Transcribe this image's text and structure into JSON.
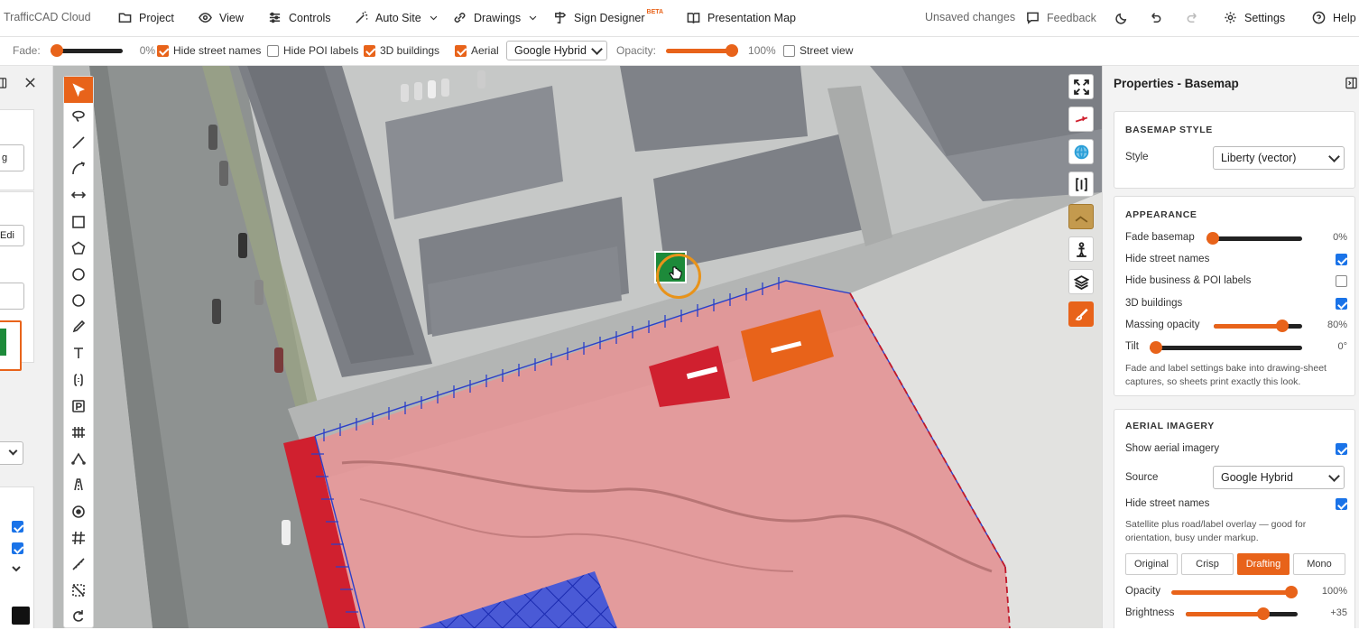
{
  "topbar": {
    "app_title": "TrafficCAD Cloud",
    "menus": [
      "Project",
      "View",
      "Controls",
      "Auto Site",
      "Drawings",
      "Sign Designer",
      "Presentation Map"
    ],
    "beta_label": "BETA",
    "status": "Unsaved changes",
    "feedback": "Feedback",
    "settings": "Settings",
    "help": "Help"
  },
  "layerbar": {
    "fade_label": "Fade:",
    "fade_value": "0%",
    "fade_level": 0,
    "hide_street_names": "Hide street names",
    "hide_poi_labels": "Hide POI labels",
    "buildings_3d": "3D buildings",
    "aerial": "Aerial",
    "source_value": "Google Hybrid",
    "opacity_label": "Opacity:",
    "opacity_value": "100%",
    "opacity_level": 100,
    "street_view": "Street view"
  },
  "leftpanel": {
    "input_tail": "g",
    "select_tail": "Edi"
  },
  "properties": {
    "title": "Properties - Basemap",
    "basemap_style": {
      "heading": "BASEMAP STYLE",
      "style_label": "Style",
      "style_value": "Liberty (vector)"
    },
    "appearance": {
      "heading": "APPEARANCE",
      "fade_label": "Fade basemap",
      "fade_value": "0%",
      "fade_level": 0,
      "hide_street_names": "Hide street names",
      "hide_business": "Hide business & POI labels",
      "buildings_3d": "3D buildings",
      "massing_label": "Massing opacity",
      "massing_value": "80%",
      "massing_level": 80,
      "tilt_label": "Tilt",
      "tilt_value": "0°",
      "tilt_level": 0,
      "note": "Fade and label settings bake into drawing-sheet captures, so sheets print exactly this look."
    },
    "aerial": {
      "heading": "AERIAL IMAGERY",
      "show_label": "Show aerial imagery",
      "source_label": "Source",
      "source_value": "Google Hybrid",
      "hide_street_names": "Hide street names",
      "note": "Satellite plus road/label overlay — good for orientation, busy under markup.",
      "presets": [
        "Original",
        "Crisp",
        "Drafting",
        "Mono"
      ],
      "active_preset": "Drafting",
      "opacity_label": "Opacity",
      "opacity_value": "100%",
      "opacity_level": 100,
      "brightness_label": "Brightness",
      "brightness_value": "+35",
      "brightness_level": 68
    }
  },
  "colors": {
    "accent": "#e8631a",
    "check_blue": "#1a73e8",
    "site_fill": "#e88a8a",
    "red_block": "#d0202f",
    "blue_hatch": "#2b3fc9"
  }
}
